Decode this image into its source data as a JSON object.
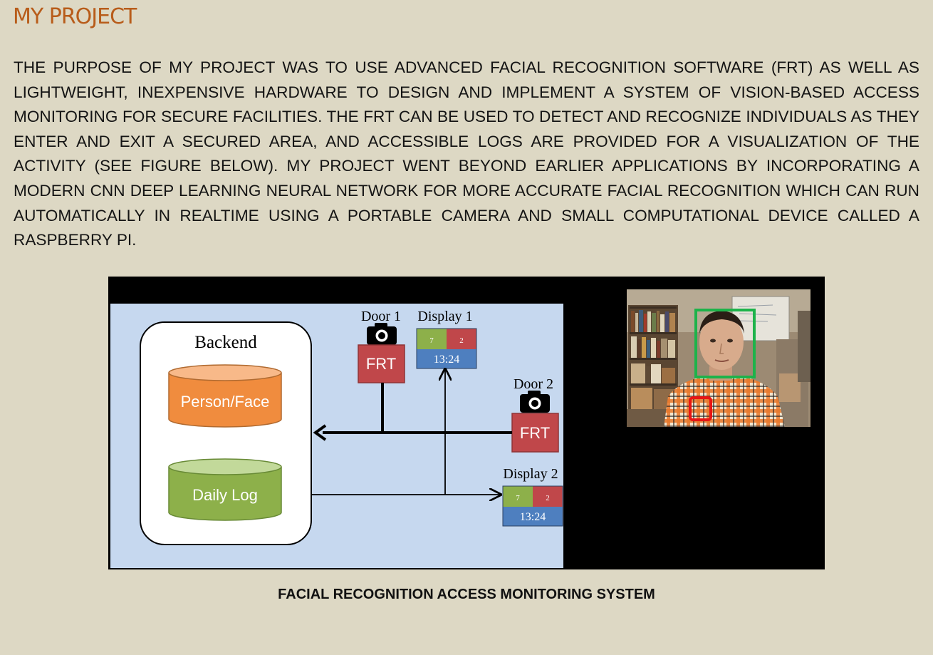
{
  "page": {
    "title": "MY PROJECT",
    "purpose": "THE PURPOSE OF MY PROJECT WAS TO USE ADVANCED FACIAL RECOGNITION SOFTWARE (FRT) AS WELL AS LIGHTWEIGHT, INEXPENSIVE HARDWARE TO DESIGN AND IMPLEMENT A SYSTEM OF VISION-BASED ACCESS MONITORING FOR SECURE FACILITIES.  THE FRT CAN BE USED TO DETECT AND RECOGNIZE INDIVIDUALS AS THEY ENTER AND EXIT A SECURED AREA, AND ACCESSIBLE LOGS ARE PROVIDED FOR A VISUALIZATION OF THE ACTIVITY (SEE FIGURE BELOW). MY PROJECT WENT BEYOND EARLIER APPLICATIONS BY INCORPORATING A MODERN CNN DEEP LEARNING NEURAL NETWORK FOR MORE ACCURATE FACIAL RECOGNITION WHICH CAN RUN AUTOMATICALLY IN REALTIME USING A PORTABLE CAMERA AND SMALL COMPUTATIONAL DEVICE CALLED A RASPBERRY PI.",
    "caption": "FACIAL RECOGNITION ACCESS MONITORING SYSTEM"
  },
  "diagram": {
    "backend_label": "Backend",
    "db_person": "Person/Face",
    "db_log": "Daily Log",
    "door1": "Door 1",
    "door2": "Door 2",
    "frt1": "FRT",
    "frt2": "FRT",
    "display1": {
      "label": "Display 1",
      "count_allowed": "7",
      "count_denied": "2",
      "time": "13:24"
    },
    "display2": {
      "label": "Display 2",
      "count_allowed": "7",
      "count_denied": "2",
      "time": "13:24"
    },
    "icons": [
      "camera-icon",
      "arrow-left-icon"
    ]
  },
  "colors": {
    "background": "#ddd8c4",
    "title": "#b85c1a",
    "diagram_bg": "#c6d8ef",
    "db_person": "#f08c3e",
    "db_log": "#8db04a",
    "frt_box": "#c0474a",
    "display_green": "#8db04a",
    "display_red": "#c0474a",
    "display_blue": "#4e7fbf",
    "face_box": "#1db34a",
    "secondary_box": "#e81414"
  }
}
